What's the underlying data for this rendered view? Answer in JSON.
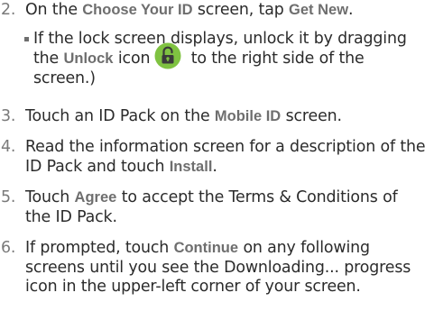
{
  "steps": [
    {
      "number": "2.",
      "t1": "On the ",
      "k1": "Choose Your ID",
      "t2": " screen, tap ",
      "k2": "Get New",
      "t3": "."
    },
    {
      "number": "3.",
      "t1": "Touch an ID Pack on the ",
      "k1": "Mobile ID",
      "t2": " screen."
    },
    {
      "number": "4.",
      "t1": "Read the information screen for a description of the ID Pack and touch ",
      "k1": "Install",
      "t2": "."
    },
    {
      "number": "5.",
      "t1": "Touch ",
      "k1": "Agree",
      "t2": " to accept the Terms & Conditions of the ID Pack."
    },
    {
      "number": "6.",
      "t1": "If prompted, touch ",
      "k1": "Continue",
      "t2": " on any following screens until you see the Downloading... progress icon in the upper-left corner of your screen."
    }
  ],
  "subitem": {
    "t1": "If the lock screen displays, unlock it by dragging the ",
    "k1": "Unlock",
    "t2": " icon",
    "t3": " to the right side of the screen.)",
    "icon": "unlock-icon",
    "icon_color": "#7fc241",
    "icon_lock_color": "#3a3a3a"
  }
}
